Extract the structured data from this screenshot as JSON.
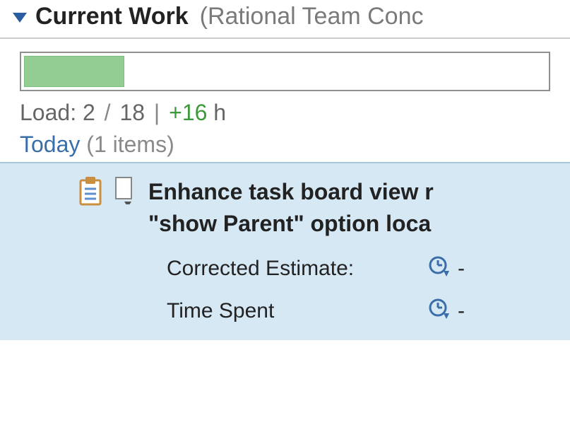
{
  "section": {
    "title": "Current Work",
    "context_prefix": "(",
    "context": "Rational Team Conc",
    "expanded": true
  },
  "progress": {
    "percent": 19
  },
  "load": {
    "prefix": "Load:",
    "current": "2",
    "total": "18",
    "separator": "/",
    "divider": "|",
    "delta": "+16",
    "unit": "h"
  },
  "group": {
    "name": "Today",
    "count_text": "(1 items)"
  },
  "item": {
    "title_line1": "Enhance task board view r",
    "title_line2": "\"show Parent\" option loca"
  },
  "details": {
    "corrected_estimate": {
      "label": "Corrected Estimate:",
      "value": "-"
    },
    "time_spent": {
      "label": "Time Spent",
      "value": "-"
    }
  }
}
